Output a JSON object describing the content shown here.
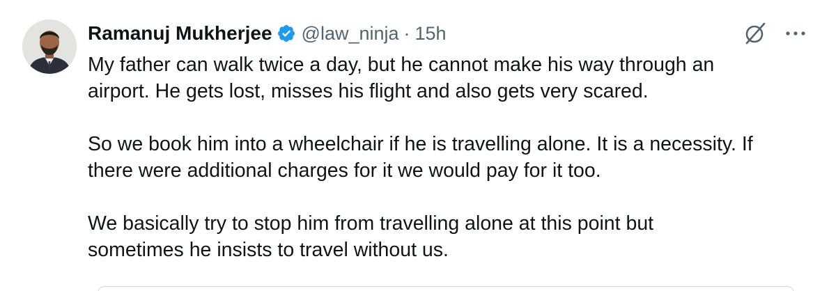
{
  "author": {
    "name": "Ramanuj Mukherjee",
    "handle": "@law_ninja",
    "separator": "·",
    "time": "15h",
    "verified": true
  },
  "icons": {
    "verified": "verified-badge-icon",
    "grok": "grok-icon",
    "more": "more-horizontal-icon"
  },
  "colors": {
    "verified_blue": "#1d9bf0",
    "secondary_text": "#536471",
    "primary_text": "#0f1419"
  },
  "tweet": {
    "paragraphs": [
      "My father can walk twice a day, but he cannot make his way through an\nairport. He gets lost, misses his flight and also gets very scared.",
      "So we book him into a wheelchair if he is travelling alone. It is a necessity. If\nthere were additional charges for it we would pay for it too.",
      "We basically try to stop him from travelling alone at this point but\nsometimes he insists to travel without us."
    ]
  }
}
